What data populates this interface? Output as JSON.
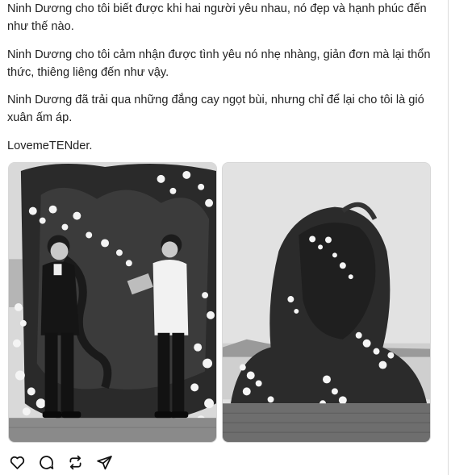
{
  "post": {
    "paragraphs": [
      "Ninh Dương cho tôi biết được khi hai người yêu nhau, nó đẹp và hạnh phúc đến như thế nào.",
      "Ninh Dương cho tôi cảm nhận được tình yêu nó nhẹ nhàng, giản đơn mà lại thổn thức, thiêng liêng đến như vậy.",
      "Ninh Dương đã trải qua những đắng cay ngọt bùi, nhưng chỉ để lại cho tôi là gió xuân ấm áp.",
      "LovemeTENder."
    ]
  },
  "media": [
    {
      "kind": "photo",
      "content": "wedding-ceremony-couple"
    },
    {
      "kind": "photo",
      "content": "floral-pampas-arch"
    }
  ],
  "actions": [
    {
      "icon": "heart-icon"
    },
    {
      "icon": "comment-icon"
    },
    {
      "icon": "repost-icon"
    },
    {
      "icon": "share-icon"
    }
  ],
  "colors": {
    "text": "#222222",
    "border": "#d8d8d8",
    "background": "#ffffff"
  }
}
